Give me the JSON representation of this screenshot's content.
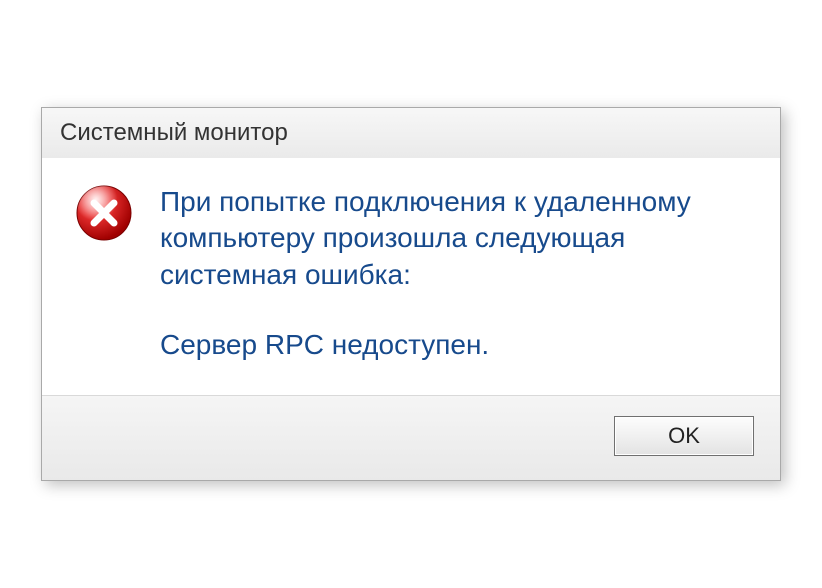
{
  "dialog": {
    "title": "Системный монитор",
    "message_line1": "При попытке подключения к удаленному компьютеру произошла следующая системная ошибка:",
    "message_line2": "Сервер RPC недоступен.",
    "ok_label": "OK",
    "icon": "error-icon"
  }
}
